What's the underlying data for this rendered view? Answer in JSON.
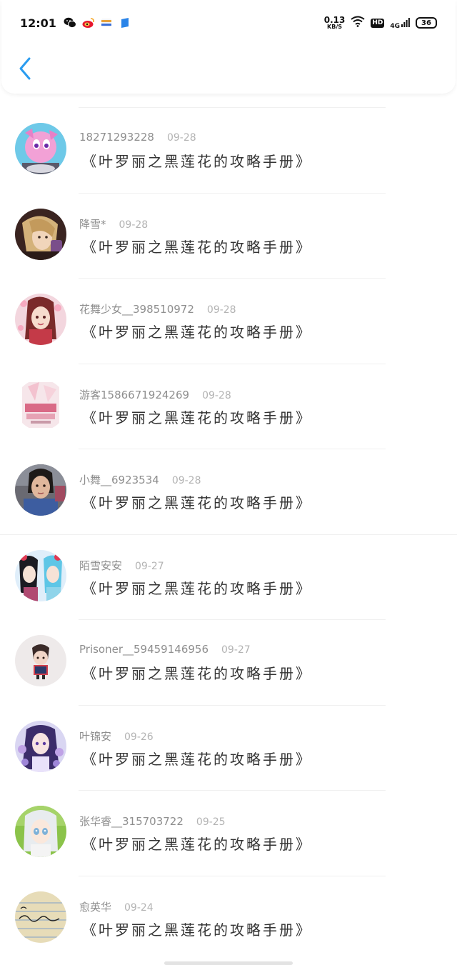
{
  "status_bar": {
    "time": "12:01",
    "net_speed": "0.13",
    "net_speed_unit": "KB/S",
    "hd": "HD",
    "network": "4G",
    "battery": "36"
  },
  "header": {
    "back_icon": "chevron-left-icon"
  },
  "colors": {
    "accent": "#2a9cf0",
    "divider": "#f0f0f0",
    "meta_text": "#9a9a9a",
    "title_text": "#333333"
  },
  "items": [
    {
      "name": "18271293228",
      "date": "09-28",
      "title": "《叶罗丽之黑莲花的攻略手册》"
    },
    {
      "name": "降雪*",
      "date": "09-28",
      "title": "《叶罗丽之黑莲花的攻略手册》"
    },
    {
      "name": "花舞少女__398510972",
      "date": "09-28",
      "title": "《叶罗丽之黑莲花的攻略手册》"
    },
    {
      "name": "游客1586671924269",
      "date": "09-28",
      "title": "《叶罗丽之黑莲花的攻略手册》"
    },
    {
      "name": "小舞__6923534",
      "date": "09-28",
      "title": "《叶罗丽之黑莲花的攻略手册》"
    },
    {
      "name": "陌雪安安",
      "date": "09-27",
      "title": "《叶罗丽之黑莲花的攻略手册》"
    },
    {
      "name": "Prisoner__59459146956",
      "date": "09-27",
      "title": "《叶罗丽之黑莲花的攻略手册》"
    },
    {
      "name": "叶锦安",
      "date": "09-26",
      "title": "《叶罗丽之黑莲花的攻略手册》"
    },
    {
      "name": "张华睿__315703722",
      "date": "09-25",
      "title": "《叶罗丽之黑莲花的攻略手册》"
    },
    {
      "name": "愈英华",
      "date": "09-24",
      "title": "《叶罗丽之黑莲花的攻略手册》"
    }
  ]
}
